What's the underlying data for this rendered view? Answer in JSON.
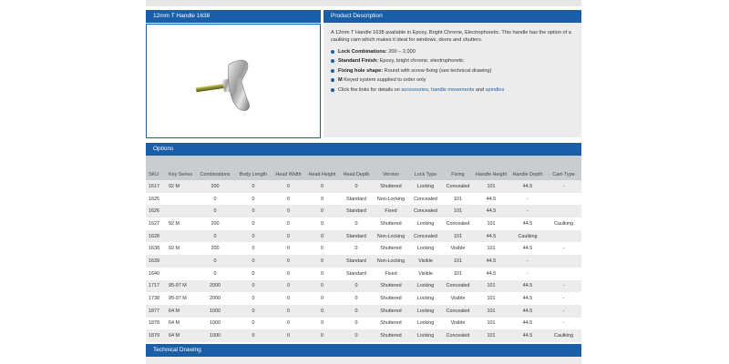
{
  "product": {
    "title": "12mm T Handle 1638",
    "image_alt": "handle photo"
  },
  "description": {
    "heading": "Product Description",
    "intro": "A 12mm T Handle 1638 available in Epoxy, Bright Chrome, Electrophoretic. This handle has the option of a caulking cam which makes it ideal for windows, doors and shutters.",
    "bullets": [
      {
        "label": "Lock Combinations:",
        "text": " 200 – 2,000"
      },
      {
        "label": "Standard Finish:",
        "text": " Epoxy, bright chrome, electrophoretic"
      },
      {
        "label": "Fixing hole shape:",
        "text": " Round with screw fixing (see technical drawing)"
      },
      {
        "label": "M",
        "text": " Keyed system supplied to order only"
      }
    ],
    "links_prefix": "Click the links for details on ",
    "link_accessories": "accessories",
    "links_sep": ", ",
    "link_movements": "handle movements",
    "links_and": " and ",
    "link_spindles": "spindles"
  },
  "options": {
    "heading": "Options",
    "columns": [
      "SKU",
      "Key Series",
      "Combinations",
      "Body Length",
      "Head Width",
      "Head Height",
      "Head Depth",
      "Version",
      "Lock Type",
      "Fixing",
      "Handle Height",
      "Handle Depth",
      "Cam Type"
    ],
    "rows": [
      [
        "1617",
        "92 M",
        "200",
        "0",
        "0",
        "0",
        "0",
        "Shuttered",
        "Locking",
        "Concealed",
        "101",
        "44.5",
        "-"
      ],
      [
        "1625",
        "",
        "0",
        "0",
        "0",
        "0",
        "Standard",
        "Non-Locking",
        "Concealed",
        "101",
        "44.5",
        "-",
        ""
      ],
      [
        "1626",
        "",
        "0",
        "0",
        "0",
        "0",
        "Standard",
        "Fixed",
        "Concealed",
        "101",
        "44.5",
        "-",
        ""
      ],
      [
        "1627",
        "92 M",
        "200",
        "0",
        "0",
        "0",
        "0",
        "Shuttered",
        "Locking",
        "Concealed",
        "101",
        "44.5",
        "Caulking"
      ],
      [
        "1628",
        "",
        "0",
        "0",
        "0",
        "0",
        "Standard",
        "Non-Locking",
        "Concealed",
        "101",
        "44.5",
        "Caulking",
        ""
      ],
      [
        "1638",
        "92 M",
        "200",
        "0",
        "0",
        "0",
        "0",
        "Shuttered",
        "Locking",
        "Visible",
        "101",
        "44.5",
        "-"
      ],
      [
        "1639",
        "",
        "0",
        "0",
        "0",
        "0",
        "Standard",
        "Non-Locking",
        "Visible",
        "101",
        "44.5",
        "-",
        ""
      ],
      [
        "1640",
        "",
        "0",
        "0",
        "0",
        "0",
        "Standard",
        "Fixed",
        "Visible",
        "101",
        "44.5",
        "-",
        ""
      ],
      [
        "1717",
        "95-97 M",
        "2000",
        "0",
        "0",
        "0",
        "0",
        "Shuttered",
        "Locking",
        "Concealed",
        "101",
        "44.5",
        "-"
      ],
      [
        "1738",
        "95-97 M",
        "2000",
        "0",
        "0",
        "0",
        "0",
        "Shuttered",
        "Locking",
        "Visible",
        "101",
        "44.5",
        "-"
      ],
      [
        "1877",
        "64 M",
        "1000",
        "0",
        "0",
        "0",
        "0",
        "Shuttered",
        "Locking",
        "Concealed",
        "101",
        "44.5",
        "-"
      ],
      [
        "1878",
        "64 M",
        "1000",
        "0",
        "0",
        "0",
        "0",
        "Shuttered",
        "Locking",
        "Visible",
        "101",
        "44.5",
        "-"
      ],
      [
        "1879",
        "64 M",
        "1000",
        "0",
        "0",
        "0",
        "0",
        "Shuttered",
        "Locking",
        "Concealed",
        "101",
        "44.5",
        "Caulking"
      ]
    ]
  },
  "technical": {
    "heading": "Technical Drawing"
  },
  "colors": {
    "accent": "#1a5ea8",
    "panel": "#ececec",
    "header_row": "#c9ccd0"
  }
}
